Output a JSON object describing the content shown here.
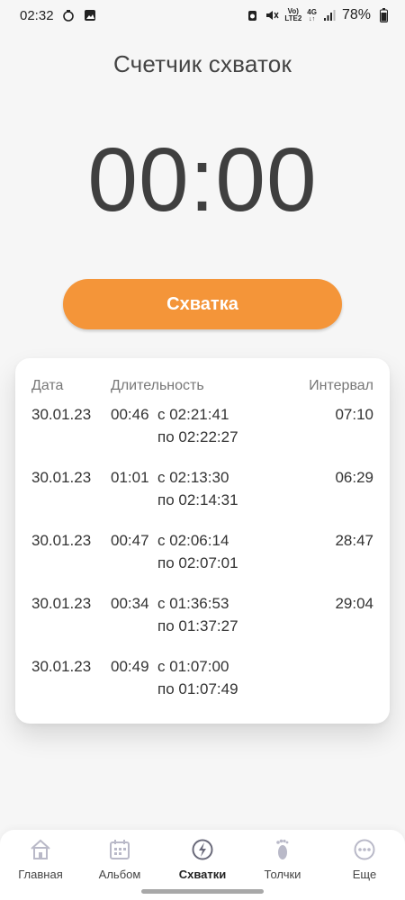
{
  "status_bar": {
    "time": "02:32",
    "net_line1": "Vo)",
    "net_line2": "LTE2",
    "net_type": "4G",
    "battery": "78%"
  },
  "page": {
    "title": "Счетчик схваток",
    "timer": "00:00",
    "button_label": "Схватка"
  },
  "table": {
    "headers": {
      "date": "Дата",
      "duration": "Длительность",
      "interval": "Интервал"
    },
    "rows": [
      {
        "date": "30.01.23",
        "duration": "00:46",
        "from": "с 02:21:41",
        "to": "по 02:22:27",
        "interval": "07:10"
      },
      {
        "date": "30.01.23",
        "duration": "01:01",
        "from": "с 02:13:30",
        "to": "по 02:14:31",
        "interval": "06:29"
      },
      {
        "date": "30.01.23",
        "duration": "00:47",
        "from": "с 02:06:14",
        "to": "по 02:07:01",
        "interval": "28:47"
      },
      {
        "date": "30.01.23",
        "duration": "00:34",
        "from": "с 01:36:53",
        "to": "по 01:37:27",
        "interval": "29:04"
      },
      {
        "date": "30.01.23",
        "duration": "00:49",
        "from": "с 01:07:00",
        "to": "по 01:07:49",
        "interval": ""
      }
    ]
  },
  "nav": {
    "items": [
      {
        "label": "Главная",
        "icon": "home-icon"
      },
      {
        "label": "Альбом",
        "icon": "calendar-icon"
      },
      {
        "label": "Схватки",
        "icon": "lightning-icon",
        "active": true
      },
      {
        "label": "Толчки",
        "icon": "footprint-icon"
      },
      {
        "label": "Еще",
        "icon": "more-icon"
      }
    ]
  },
  "colors": {
    "accent": "#f49539",
    "background": "#f6f6f6",
    "card": "#ffffff",
    "nav_icon": "#b9b9c8"
  }
}
